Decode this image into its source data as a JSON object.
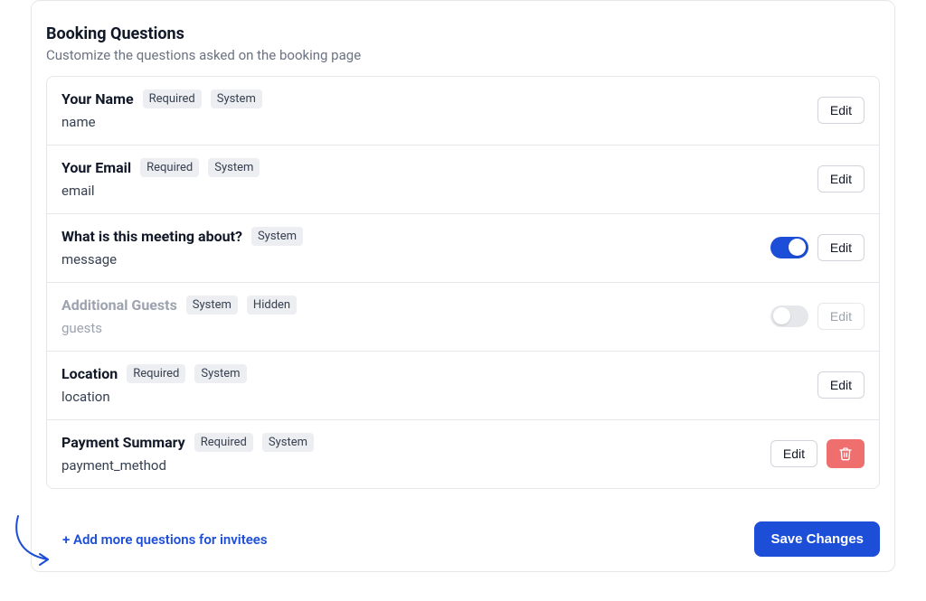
{
  "header": {
    "title": "Booking Questions",
    "subtitle": "Customize the questions asked on the booking page"
  },
  "common": {
    "edit_label": "Edit"
  },
  "badges": {
    "required": "Required",
    "system": "System",
    "hidden": "Hidden"
  },
  "questions": [
    {
      "title": "Your Name",
      "field": "name",
      "badges": [
        "required",
        "system"
      ],
      "toggle": null,
      "disabled": false,
      "delete_button": false
    },
    {
      "title": "Your Email",
      "field": "email",
      "badges": [
        "required",
        "system"
      ],
      "toggle": null,
      "disabled": false,
      "delete_button": false
    },
    {
      "title": "What is this meeting about?",
      "field": "message",
      "badges": [
        "system"
      ],
      "toggle": true,
      "disabled": false,
      "delete_button": false
    },
    {
      "title": "Additional Guests",
      "field": "guests",
      "badges": [
        "system",
        "hidden"
      ],
      "toggle": false,
      "disabled": true,
      "delete_button": false
    },
    {
      "title": "Location",
      "field": "location",
      "badges": [
        "required",
        "system"
      ],
      "toggle": null,
      "disabled": false,
      "delete_button": false
    },
    {
      "title": "Payment Summary",
      "field": "payment_method",
      "badges": [
        "required",
        "system"
      ],
      "toggle": null,
      "disabled": false,
      "delete_button": true
    }
  ],
  "footer": {
    "add_link": "+ Add more questions for invitees",
    "save_button": "Save Changes"
  }
}
